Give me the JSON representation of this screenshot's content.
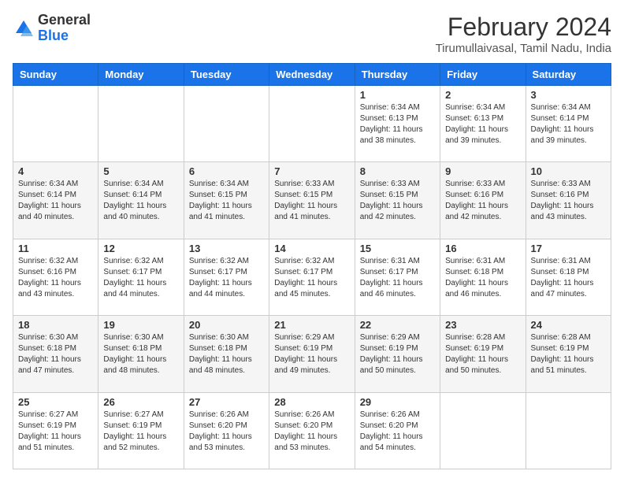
{
  "logo": {
    "general": "General",
    "blue": "Blue"
  },
  "header": {
    "title": "February 2024",
    "subtitle": "Tirumullaivasal, Tamil Nadu, India"
  },
  "weekdays": [
    "Sunday",
    "Monday",
    "Tuesday",
    "Wednesday",
    "Thursday",
    "Friday",
    "Saturday"
  ],
  "weeks": [
    [
      {
        "day": "",
        "info": ""
      },
      {
        "day": "",
        "info": ""
      },
      {
        "day": "",
        "info": ""
      },
      {
        "day": "",
        "info": ""
      },
      {
        "day": "1",
        "info": "Sunrise: 6:34 AM\nSunset: 6:13 PM\nDaylight: 11 hours\nand 38 minutes."
      },
      {
        "day": "2",
        "info": "Sunrise: 6:34 AM\nSunset: 6:13 PM\nDaylight: 11 hours\nand 39 minutes."
      },
      {
        "day": "3",
        "info": "Sunrise: 6:34 AM\nSunset: 6:14 PM\nDaylight: 11 hours\nand 39 minutes."
      }
    ],
    [
      {
        "day": "4",
        "info": "Sunrise: 6:34 AM\nSunset: 6:14 PM\nDaylight: 11 hours\nand 40 minutes."
      },
      {
        "day": "5",
        "info": "Sunrise: 6:34 AM\nSunset: 6:14 PM\nDaylight: 11 hours\nand 40 minutes."
      },
      {
        "day": "6",
        "info": "Sunrise: 6:34 AM\nSunset: 6:15 PM\nDaylight: 11 hours\nand 41 minutes."
      },
      {
        "day": "7",
        "info": "Sunrise: 6:33 AM\nSunset: 6:15 PM\nDaylight: 11 hours\nand 41 minutes."
      },
      {
        "day": "8",
        "info": "Sunrise: 6:33 AM\nSunset: 6:15 PM\nDaylight: 11 hours\nand 42 minutes."
      },
      {
        "day": "9",
        "info": "Sunrise: 6:33 AM\nSunset: 6:16 PM\nDaylight: 11 hours\nand 42 minutes."
      },
      {
        "day": "10",
        "info": "Sunrise: 6:33 AM\nSunset: 6:16 PM\nDaylight: 11 hours\nand 43 minutes."
      }
    ],
    [
      {
        "day": "11",
        "info": "Sunrise: 6:32 AM\nSunset: 6:16 PM\nDaylight: 11 hours\nand 43 minutes."
      },
      {
        "day": "12",
        "info": "Sunrise: 6:32 AM\nSunset: 6:17 PM\nDaylight: 11 hours\nand 44 minutes."
      },
      {
        "day": "13",
        "info": "Sunrise: 6:32 AM\nSunset: 6:17 PM\nDaylight: 11 hours\nand 44 minutes."
      },
      {
        "day": "14",
        "info": "Sunrise: 6:32 AM\nSunset: 6:17 PM\nDaylight: 11 hours\nand 45 minutes."
      },
      {
        "day": "15",
        "info": "Sunrise: 6:31 AM\nSunset: 6:17 PM\nDaylight: 11 hours\nand 46 minutes."
      },
      {
        "day": "16",
        "info": "Sunrise: 6:31 AM\nSunset: 6:18 PM\nDaylight: 11 hours\nand 46 minutes."
      },
      {
        "day": "17",
        "info": "Sunrise: 6:31 AM\nSunset: 6:18 PM\nDaylight: 11 hours\nand 47 minutes."
      }
    ],
    [
      {
        "day": "18",
        "info": "Sunrise: 6:30 AM\nSunset: 6:18 PM\nDaylight: 11 hours\nand 47 minutes."
      },
      {
        "day": "19",
        "info": "Sunrise: 6:30 AM\nSunset: 6:18 PM\nDaylight: 11 hours\nand 48 minutes."
      },
      {
        "day": "20",
        "info": "Sunrise: 6:30 AM\nSunset: 6:18 PM\nDaylight: 11 hours\nand 48 minutes."
      },
      {
        "day": "21",
        "info": "Sunrise: 6:29 AM\nSunset: 6:19 PM\nDaylight: 11 hours\nand 49 minutes."
      },
      {
        "day": "22",
        "info": "Sunrise: 6:29 AM\nSunset: 6:19 PM\nDaylight: 11 hours\nand 50 minutes."
      },
      {
        "day": "23",
        "info": "Sunrise: 6:28 AM\nSunset: 6:19 PM\nDaylight: 11 hours\nand 50 minutes."
      },
      {
        "day": "24",
        "info": "Sunrise: 6:28 AM\nSunset: 6:19 PM\nDaylight: 11 hours\nand 51 minutes."
      }
    ],
    [
      {
        "day": "25",
        "info": "Sunrise: 6:27 AM\nSunset: 6:19 PM\nDaylight: 11 hours\nand 51 minutes."
      },
      {
        "day": "26",
        "info": "Sunrise: 6:27 AM\nSunset: 6:19 PM\nDaylight: 11 hours\nand 52 minutes."
      },
      {
        "day": "27",
        "info": "Sunrise: 6:26 AM\nSunset: 6:20 PM\nDaylight: 11 hours\nand 53 minutes."
      },
      {
        "day": "28",
        "info": "Sunrise: 6:26 AM\nSunset: 6:20 PM\nDaylight: 11 hours\nand 53 minutes."
      },
      {
        "day": "29",
        "info": "Sunrise: 6:26 AM\nSunset: 6:20 PM\nDaylight: 11 hours\nand 54 minutes."
      },
      {
        "day": "",
        "info": ""
      },
      {
        "day": "",
        "info": ""
      }
    ]
  ]
}
